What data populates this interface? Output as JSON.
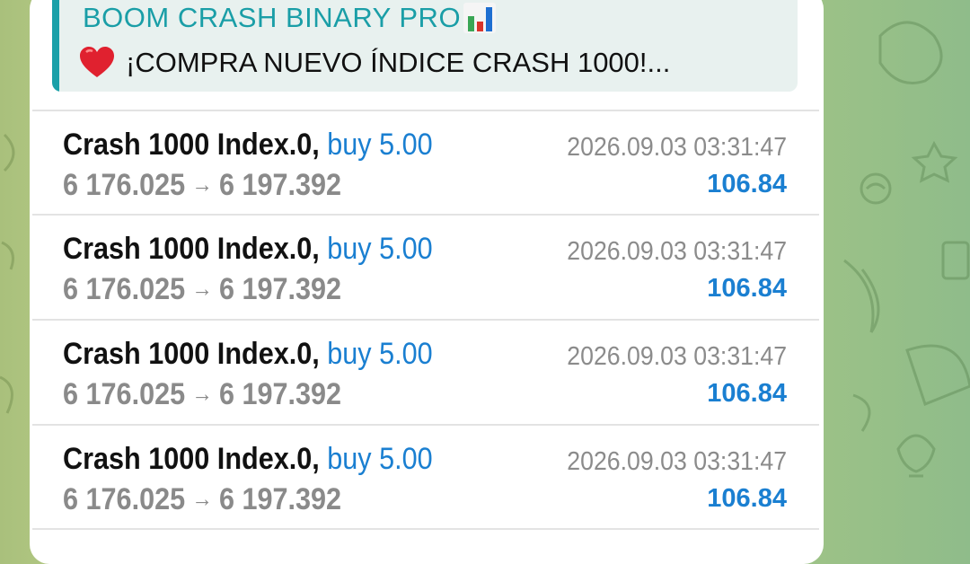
{
  "reply": {
    "title": "BOOM CRASH BINARY PRO",
    "title_icon": "bar-chart-icon",
    "text": "¡COMPRA NUEVO ÍNDICE CRASH 1000!...",
    "text_icon": "heart-icon"
  },
  "colors": {
    "accent": "#1aa0a8",
    "buy": "#1a7fd1",
    "profit": "#1a7fd1",
    "muted": "#8a8a8a"
  },
  "trades": [
    {
      "symbol": "Crash 1000 Index.0,",
      "action": "buy 5.00",
      "open_price": "6 176.025",
      "arrow": "→",
      "close_price": "6 197.392",
      "time": "2026.09.03 03:31:47",
      "profit": "106.84"
    },
    {
      "symbol": "Crash 1000 Index.0,",
      "action": "buy 5.00",
      "open_price": "6 176.025",
      "arrow": "→",
      "close_price": "6 197.392",
      "time": "2026.09.03 03:31:47",
      "profit": "106.84"
    },
    {
      "symbol": "Crash 1000 Index.0,",
      "action": "buy 5.00",
      "open_price": "6 176.025",
      "arrow": "→",
      "close_price": "6 197.392",
      "time": "2026.09.03 03:31:47",
      "profit": "106.84"
    },
    {
      "symbol": "Crash 1000 Index.0,",
      "action": "buy 5.00",
      "open_price": "6 176.025",
      "arrow": "→",
      "close_price": "6 197.392",
      "time": "2026.09.03 03:31:47",
      "profit": "106.84"
    }
  ]
}
